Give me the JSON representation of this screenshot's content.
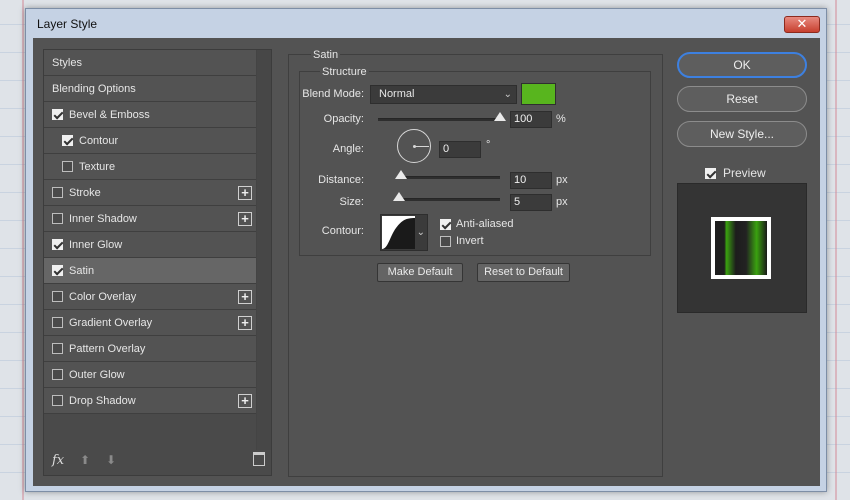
{
  "window": {
    "title": "Layer Style",
    "close_glyph": "✕"
  },
  "styles_list": {
    "items": [
      {
        "id": "styles",
        "label": "Styles",
        "type": "header",
        "checked": null,
        "plus": false,
        "indent": false,
        "selected": false
      },
      {
        "id": "blending-options",
        "label": "Blending Options",
        "type": "header",
        "checked": null,
        "plus": false,
        "indent": false,
        "selected": false
      },
      {
        "id": "bevel-emboss",
        "label": "Bevel & Emboss",
        "type": "check",
        "checked": true,
        "plus": false,
        "indent": false,
        "selected": false
      },
      {
        "id": "contour",
        "label": "Contour",
        "type": "check",
        "checked": true,
        "plus": false,
        "indent": true,
        "selected": false
      },
      {
        "id": "texture",
        "label": "Texture",
        "type": "check",
        "checked": false,
        "plus": false,
        "indent": true,
        "selected": false
      },
      {
        "id": "stroke",
        "label": "Stroke",
        "type": "check",
        "checked": false,
        "plus": true,
        "indent": false,
        "selected": false
      },
      {
        "id": "inner-shadow",
        "label": "Inner Shadow",
        "type": "check",
        "checked": false,
        "plus": true,
        "indent": false,
        "selected": false
      },
      {
        "id": "inner-glow",
        "label": "Inner Glow",
        "type": "check",
        "checked": true,
        "plus": false,
        "indent": false,
        "selected": false
      },
      {
        "id": "satin",
        "label": "Satin",
        "type": "check",
        "checked": true,
        "plus": false,
        "indent": false,
        "selected": true
      },
      {
        "id": "color-overlay",
        "label": "Color Overlay",
        "type": "check",
        "checked": false,
        "plus": true,
        "indent": false,
        "selected": false
      },
      {
        "id": "gradient-overlay",
        "label": "Gradient Overlay",
        "type": "check",
        "checked": false,
        "plus": true,
        "indent": false,
        "selected": false
      },
      {
        "id": "pattern-overlay",
        "label": "Pattern Overlay",
        "type": "check",
        "checked": false,
        "plus": false,
        "indent": false,
        "selected": false
      },
      {
        "id": "outer-glow",
        "label": "Outer Glow",
        "type": "check",
        "checked": false,
        "plus": false,
        "indent": false,
        "selected": false
      },
      {
        "id": "drop-shadow",
        "label": "Drop Shadow",
        "type": "check",
        "checked": false,
        "plus": true,
        "indent": false,
        "selected": false
      }
    ],
    "footer": {
      "fx_label": "fx",
      "up_glyph": "⬆",
      "down_glyph": "⬇"
    }
  },
  "satin": {
    "group_title": "Satin",
    "structure_title": "Structure",
    "blend_mode": {
      "label": "Blend Mode:",
      "value": "Normal",
      "color": "#58b51e"
    },
    "opacity": {
      "label": "Opacity:",
      "value": "100",
      "unit": "%",
      "fraction": 1.0
    },
    "angle": {
      "label": "Angle:",
      "value": "0",
      "unit": "°"
    },
    "distance": {
      "label": "Distance:",
      "value": "10",
      "unit": "px",
      "fraction": 0.04
    },
    "size": {
      "label": "Size:",
      "value": "5",
      "unit": "px",
      "fraction": 0.02
    },
    "contour": {
      "label": "Contour:",
      "anti_aliased_label": "Anti-aliased",
      "anti_aliased": true,
      "invert_label": "Invert",
      "invert": false
    },
    "make_default_label": "Make Default",
    "reset_default_label": "Reset to Default"
  },
  "actions": {
    "ok_label": "OK",
    "reset_label": "Reset",
    "new_style_label": "New Style...",
    "preview_label": "Preview",
    "preview_checked": true
  }
}
